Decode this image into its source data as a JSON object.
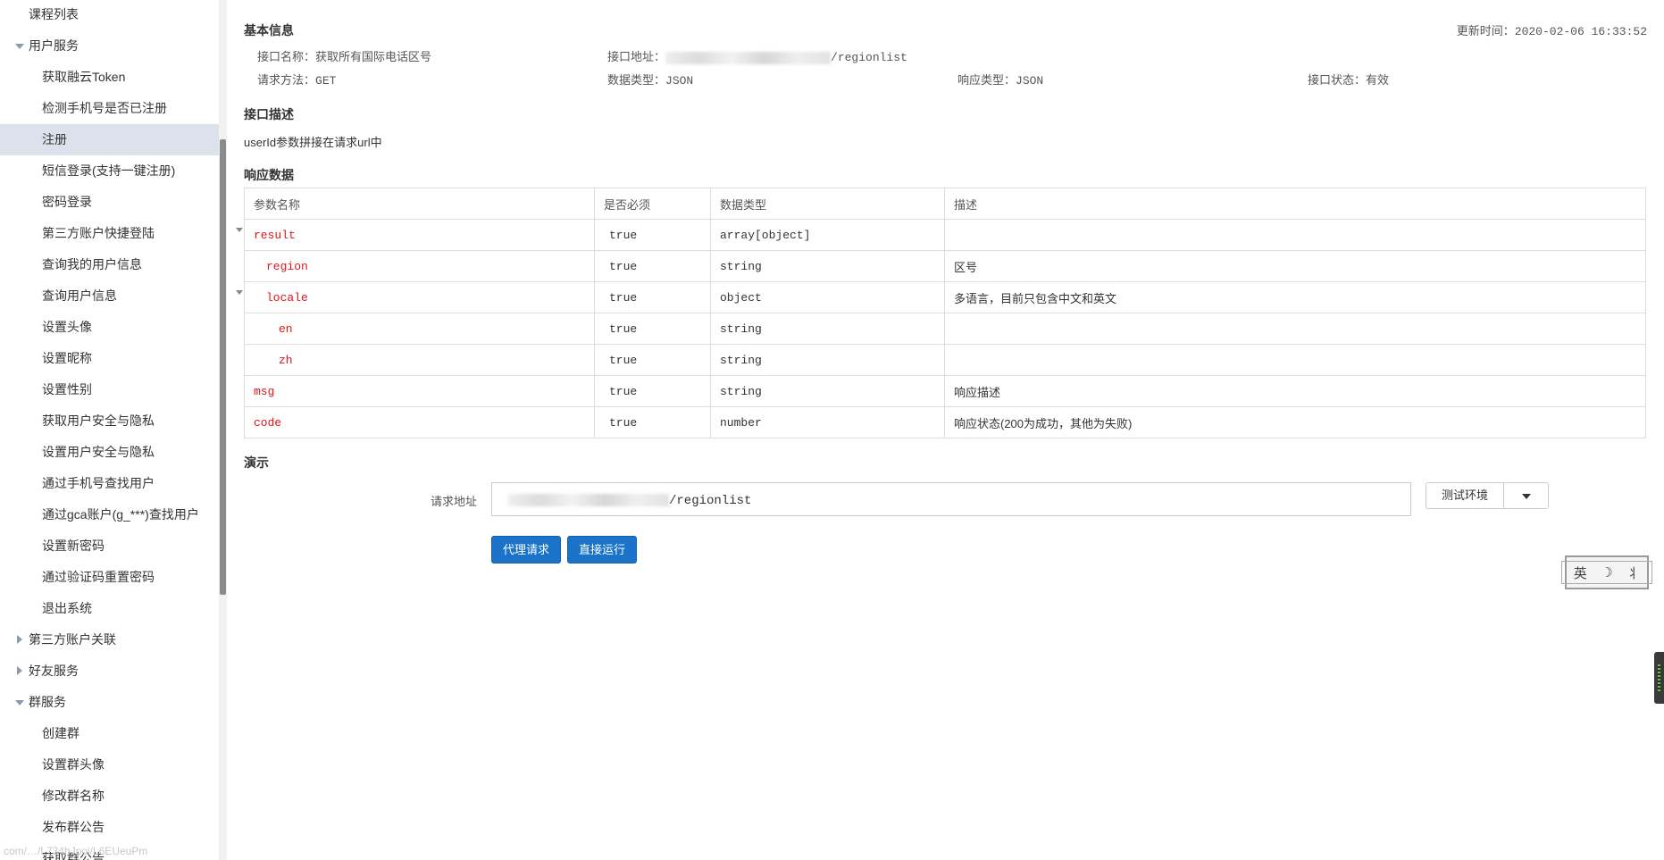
{
  "sidebar": {
    "items": [
      {
        "label": "课程列表",
        "level": "group",
        "caret": "none"
      },
      {
        "label": "用户服务",
        "level": "group",
        "caret": "down"
      },
      {
        "label": "获取融云Token",
        "level": "child",
        "caret": "none"
      },
      {
        "label": "检测手机号是否已注册",
        "level": "child",
        "caret": "none"
      },
      {
        "label": "注册",
        "level": "child",
        "caret": "none",
        "active": true
      },
      {
        "label": "短信登录(支持一键注册)",
        "level": "child",
        "caret": "none"
      },
      {
        "label": "密码登录",
        "level": "child",
        "caret": "none"
      },
      {
        "label": "第三方账户快捷登陆",
        "level": "child",
        "caret": "none"
      },
      {
        "label": "查询我的用户信息",
        "level": "child",
        "caret": "none"
      },
      {
        "label": "查询用户信息",
        "level": "child",
        "caret": "none"
      },
      {
        "label": "设置头像",
        "level": "child",
        "caret": "none"
      },
      {
        "label": "设置昵称",
        "level": "child",
        "caret": "none"
      },
      {
        "label": "设置性别",
        "level": "child",
        "caret": "none"
      },
      {
        "label": "获取用户安全与隐私",
        "level": "child",
        "caret": "none"
      },
      {
        "label": "设置用户安全与隐私",
        "level": "child",
        "caret": "none"
      },
      {
        "label": "通过手机号查找用户",
        "level": "child",
        "caret": "none"
      },
      {
        "label": "通过gca账户(g_***)查找用户",
        "level": "child",
        "caret": "none"
      },
      {
        "label": "设置新密码",
        "level": "child",
        "caret": "none"
      },
      {
        "label": "通过验证码重置密码",
        "level": "child",
        "caret": "none"
      },
      {
        "label": "退出系统",
        "level": "child",
        "caret": "none"
      },
      {
        "label": "第三方账户关联",
        "level": "group",
        "caret": "right"
      },
      {
        "label": "好友服务",
        "level": "group",
        "caret": "right"
      },
      {
        "label": "群服务",
        "level": "group",
        "caret": "down"
      },
      {
        "label": "创建群",
        "level": "child",
        "caret": "none"
      },
      {
        "label": "设置群头像",
        "level": "child",
        "caret": "none"
      },
      {
        "label": "修改群名称",
        "level": "child",
        "caret": "none"
      },
      {
        "label": "发布群公告",
        "level": "child",
        "caret": "none"
      },
      {
        "label": "获取群公告",
        "level": "child",
        "caret": "none"
      }
    ],
    "url_ghost": "com/…/L734hJpoi/L6EUeuPm"
  },
  "basic_info": {
    "title": "基本信息",
    "update_time_label": "更新时间：",
    "update_time": "2020-02-06 16:33:52",
    "name_label": "接口名称：",
    "name_value": "获取所有国际电话区号",
    "address_label": "接口地址：",
    "address_suffix": "/regionlist",
    "method_label": "请求方法：",
    "method_value": "GET",
    "data_type_label": "数据类型：",
    "data_type_value": "JSON",
    "resp_type_label": "响应类型：",
    "resp_type_value": "JSON",
    "status_label": "接口状态：",
    "status_value": "有效"
  },
  "description": {
    "title": "接口描述",
    "text": "userId参数拼接在请求url中"
  },
  "response": {
    "title": "响应数据",
    "headers": [
      "参数名称",
      "是否必须",
      "数据类型",
      "描述"
    ],
    "rows": [
      {
        "name": "result",
        "required": "true",
        "type": "array[object]",
        "desc": "",
        "indent": 0,
        "expandable": true
      },
      {
        "name": "region",
        "required": "true",
        "type": "string",
        "desc": "区号",
        "indent": 1,
        "expandable": false
      },
      {
        "name": "locale",
        "required": "true",
        "type": "object",
        "desc": "多语言，目前只包含中文和英文",
        "indent": 1,
        "expandable": true
      },
      {
        "name": "en",
        "required": "true",
        "type": "string",
        "desc": "",
        "indent": 2,
        "expandable": false
      },
      {
        "name": "zh",
        "required": "true",
        "type": "string",
        "desc": "",
        "indent": 2,
        "expandable": false
      },
      {
        "name": "msg",
        "required": "true",
        "type": "string",
        "desc": "响应描述",
        "indent": 0,
        "expandable": false
      },
      {
        "name": "code",
        "required": "true",
        "type": "number",
        "desc": "响应状态(200为成功，其他为失败)",
        "indent": 0,
        "expandable": false
      }
    ]
  },
  "demo": {
    "title": "演示",
    "request_label": "请求地址",
    "request_value_suffix": "/regionlist",
    "env_label": "测试环境",
    "proxy_button": "代理请求",
    "run_button": "直接运行"
  },
  "ime": {
    "chars": [
      "英",
      "☽",
      "⺦"
    ]
  }
}
